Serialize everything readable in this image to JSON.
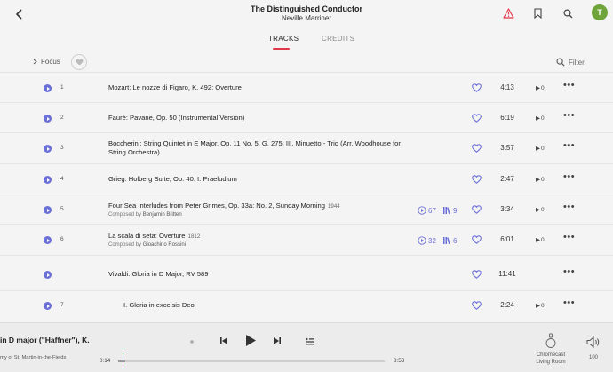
{
  "header": {
    "album_title": "The Distinguished Conductor",
    "artist": "Neville Marriner",
    "avatar_letter": "T"
  },
  "tabs": [
    {
      "label": "TRACKS",
      "active": true
    },
    {
      "label": "CREDITS",
      "active": false
    }
  ],
  "toolbar": {
    "focus_label": "Focus",
    "filter_label": "Filter"
  },
  "tracks": [
    {
      "number": "1",
      "title": "Mozart: Le nozze di Figaro, K. 492: Overture",
      "duration": "4:13",
      "plays": "0"
    },
    {
      "number": "2",
      "title": "Fauré: Pavane, Op. 50 (Instrumental Version)",
      "duration": "6:19",
      "plays": "0"
    },
    {
      "number": "3",
      "title": "Boccherini: String Quintet in E Major, Op. 11 No. 5, G. 275: III. Minuetto - Trio (Arr. Woodhouse for String Orchestra)",
      "duration": "3:57",
      "plays": "0"
    },
    {
      "number": "4",
      "title": "Grieg: Holberg Suite, Op. 40: I. Praeludium",
      "duration": "2:47",
      "plays": "0"
    },
    {
      "number": "5",
      "title": "Four Sea Interludes from Peter Grimes, Op. 33a: No. 2, Sunday Morning",
      "year": "1944",
      "composer_prefix": "Composed by",
      "composer": "Benjamin Britten",
      "stat_plays": "67",
      "stat_versions": "9",
      "duration": "3:34",
      "plays": "0"
    },
    {
      "number": "6",
      "title": "La scala di seta: Overture",
      "year": "1812",
      "composer_prefix": "Composed by",
      "composer": "Gioachino Rossini",
      "stat_plays": "32",
      "stat_versions": "6",
      "duration": "6:01",
      "plays": "0"
    },
    {
      "number": "",
      "title": "Vivaldi: Gloria in D Major, RV 589",
      "duration": "11:41"
    },
    {
      "number": "7",
      "title": "I. Gloria in excelsis Deo",
      "duration": "2:24",
      "plays": "0"
    }
  ],
  "player": {
    "now_playing_title": "in D major (\"Haffner\"), K.",
    "now_playing_subtitle": "my of St. Martin-in-the-Fields",
    "elapsed": "0:14",
    "total": "8:53",
    "progress": 0.026,
    "device_name": "Chromecast",
    "device_room": "Living Room",
    "volume": "100"
  },
  "colors": {
    "accent": "#6b6fd8",
    "highlight": "#e0394a",
    "avatar": "#6fa43a"
  }
}
